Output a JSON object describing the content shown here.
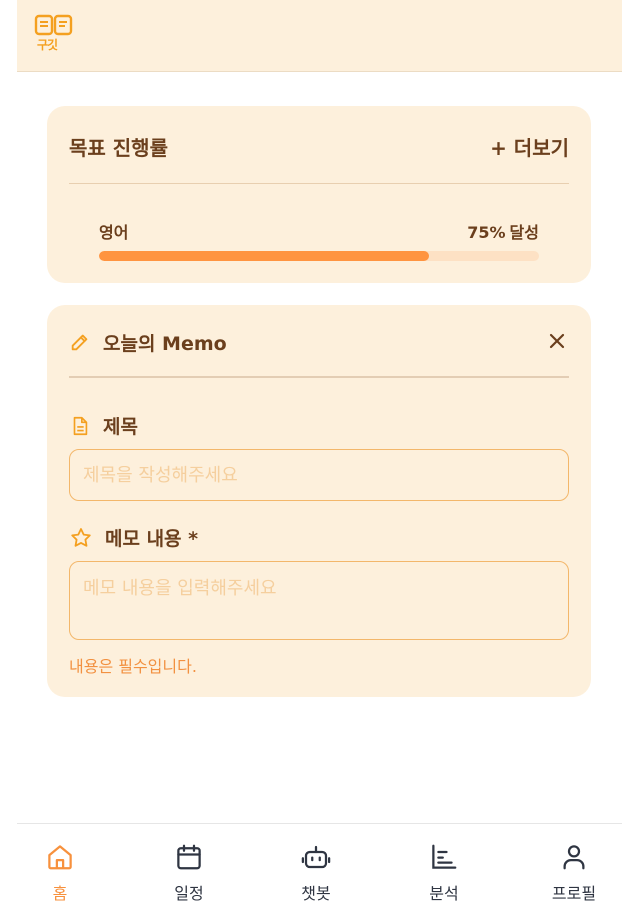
{
  "header": {
    "logo_text": "구깃"
  },
  "goal_card": {
    "title": "목표 진행률",
    "more_label": "+ 더보기",
    "goal_name": "영어",
    "progress_percent": 75,
    "progress_text": "75%",
    "status_text": "달성"
  },
  "memo_card": {
    "title": "오늘의 Memo",
    "title_field_label": "제목",
    "title_placeholder": "제목을 작성해주세요",
    "content_field_label": "메모 내용 *",
    "content_placeholder": "메모 내용을 입력해주세요",
    "hint": "내용은 필수입니다."
  },
  "bottom_nav": {
    "items": [
      {
        "label": "홈",
        "icon": "home-icon",
        "active": true
      },
      {
        "label": "일정",
        "icon": "calendar-icon",
        "active": false
      },
      {
        "label": "챗봇",
        "icon": "bot-icon",
        "active": false
      },
      {
        "label": "분석",
        "icon": "bar-chart-icon",
        "active": false
      },
      {
        "label": "프로필",
        "icon": "user-icon",
        "active": false
      }
    ]
  },
  "colors": {
    "accent": "#ff9440",
    "card_bg": "#fdf0dc",
    "text": "#6b3f1d",
    "icon_accent": "#f4a020"
  }
}
